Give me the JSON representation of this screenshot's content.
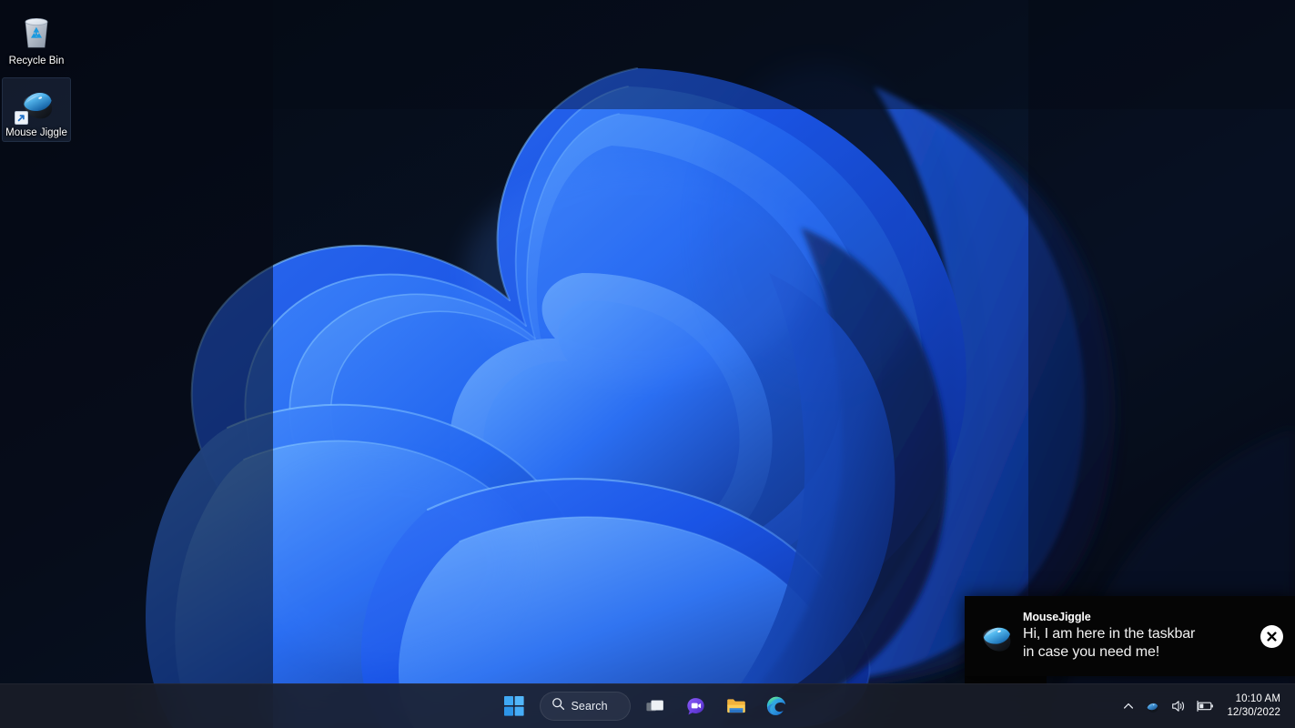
{
  "desktop": {
    "wallpaper_name": "Windows 11 Bloom",
    "background_color": "#060c18",
    "accent_color": "#2563eb",
    "icons": [
      {
        "label": "Recycle Bin",
        "icon": "recycle-bin-icon",
        "selected": false,
        "shortcut": false
      },
      {
        "label": "Mouse Jiggle",
        "icon": "mouse-icon",
        "selected": true,
        "shortcut": true
      }
    ]
  },
  "notification": {
    "app_name": "MouseJiggle",
    "message": "Hi, I am here in the taskbar\nin case you need me!",
    "icon": "mouse-icon",
    "close_label": "Close",
    "background_color": "#050505",
    "text_color": "#f2f2f2"
  },
  "taskbar": {
    "background_color": "#1a1e28",
    "items": [
      {
        "name": "start",
        "label": "Start",
        "icon": "windows-logo-icon"
      },
      {
        "name": "search",
        "label": "Search",
        "icon": "search-icon",
        "type": "pill"
      },
      {
        "name": "task-view",
        "label": "Task View",
        "icon": "task-view-icon"
      },
      {
        "name": "chat",
        "label": "Chat",
        "icon": "chat-icon"
      },
      {
        "name": "file-explorer",
        "label": "File Explorer",
        "icon": "folder-icon"
      },
      {
        "name": "edge",
        "label": "Microsoft Edge",
        "icon": "edge-icon"
      }
    ],
    "tray": [
      {
        "name": "show-hidden-icons",
        "label": "Show hidden icons",
        "icon": "chevron-up-icon"
      },
      {
        "name": "mouse-jiggle-tray",
        "label": "MouseJiggle",
        "icon": "mouse-icon"
      },
      {
        "name": "volume",
        "label": "Volume",
        "icon": "speaker-icon"
      },
      {
        "name": "battery",
        "label": "Battery",
        "icon": "battery-icon"
      }
    ],
    "clock": {
      "time": "10:10 AM",
      "date": "12/30/2022"
    }
  }
}
